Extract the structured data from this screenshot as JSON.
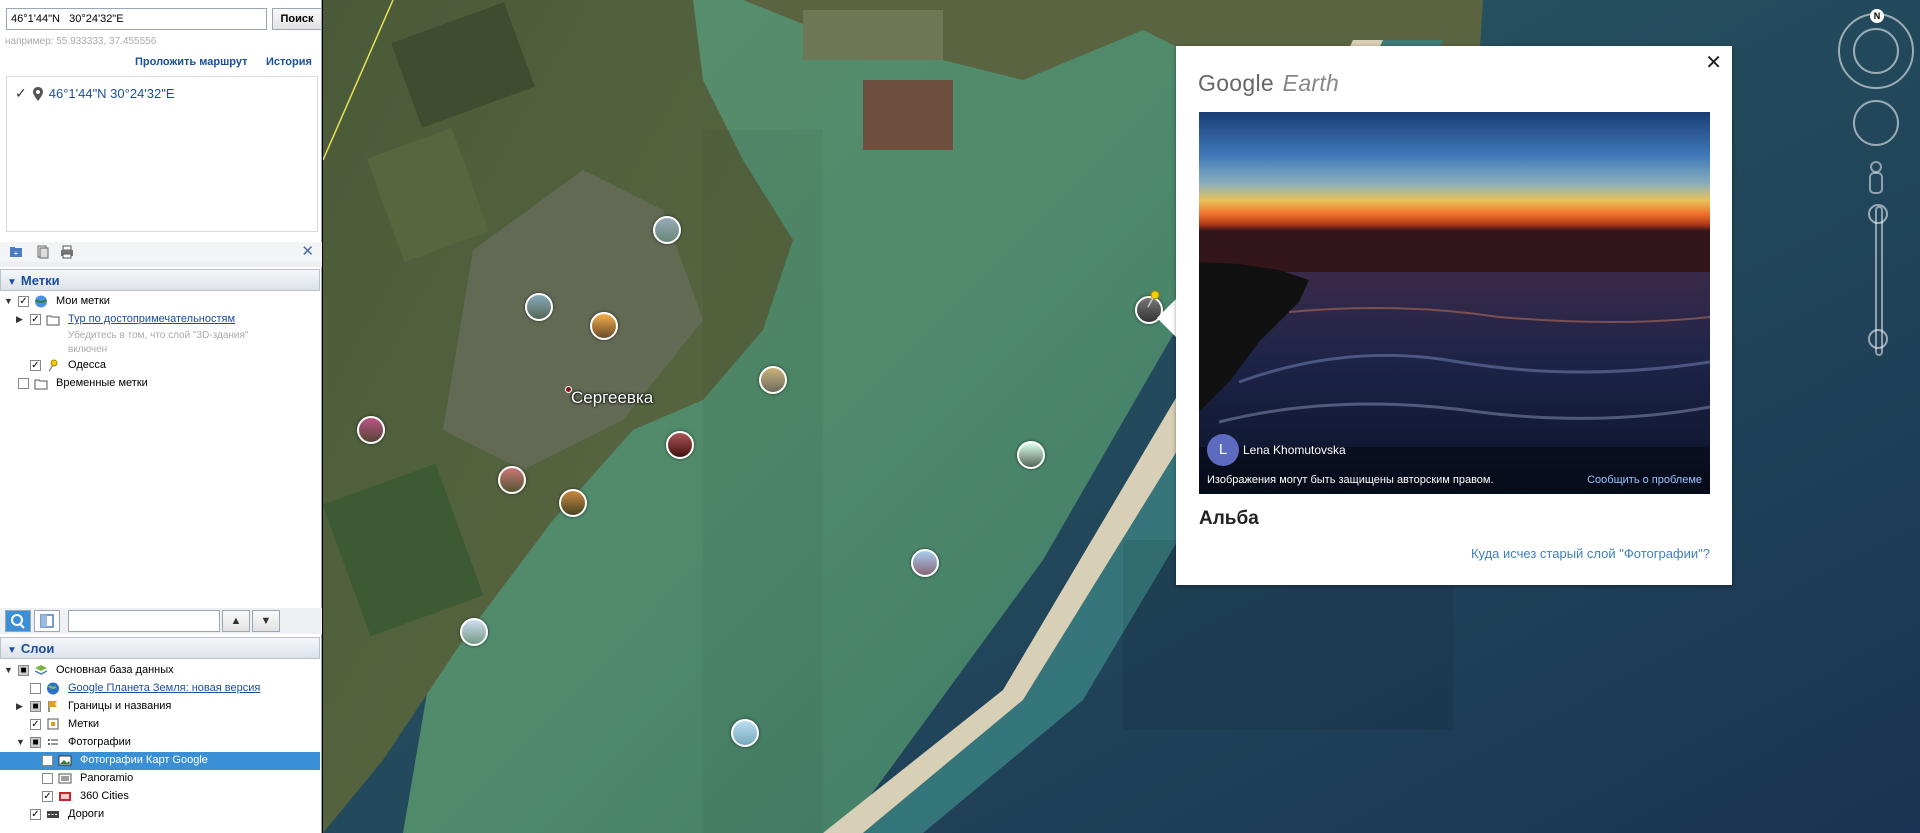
{
  "search": {
    "value": "46°1'44\"N   30°24'32\"E",
    "button_label": "Поиск",
    "hint": "например: 55.933333, 37.455556",
    "route_link": "Проложить маршрут",
    "history_link": "История",
    "result": "46°1'44\"N 30°24'32\"E"
  },
  "places": {
    "header": "Метки",
    "items": {
      "my_places": "Мои метки",
      "tour": "Тур по достопримечательностям",
      "tour_note_1": "Убедитесь в том, что слой \"3D-здания\"",
      "tour_note_2": "включен",
      "odessa": "Одесса",
      "temp_places": "Временные метки"
    }
  },
  "layers": {
    "header": "Слои",
    "items": {
      "primary_db": "Основная база данных",
      "new_version": "Google Планета Земля: новая версия",
      "borders": "Границы и названия",
      "placemarks": "Метки",
      "photos": "Фотографии",
      "gmaps_photos": "Фотографии Карт Google",
      "panoramio": "Panoramio",
      "cities360": "360 Cities",
      "roads": "Дороги"
    }
  },
  "map": {
    "town_label": "Сергеевка",
    "north_label": "N"
  },
  "balloon": {
    "brand_google": "Google",
    "brand_earth": "Earth",
    "author_initial": "L",
    "author_name": "Lena Khomutovska",
    "copyright": "Изображения могут быть защищены авторским правом.",
    "report_link": "Сообщить о проблеме",
    "title": "Альба",
    "old_layer_link": "Куда исчез старый слой \"Фотографии\"?",
    "close_label": "✕"
  },
  "colors": {
    "link_blue": "#1a4f9b",
    "selection_blue": "#3b8fd4",
    "avatar_purple": "#5c6bc0"
  }
}
